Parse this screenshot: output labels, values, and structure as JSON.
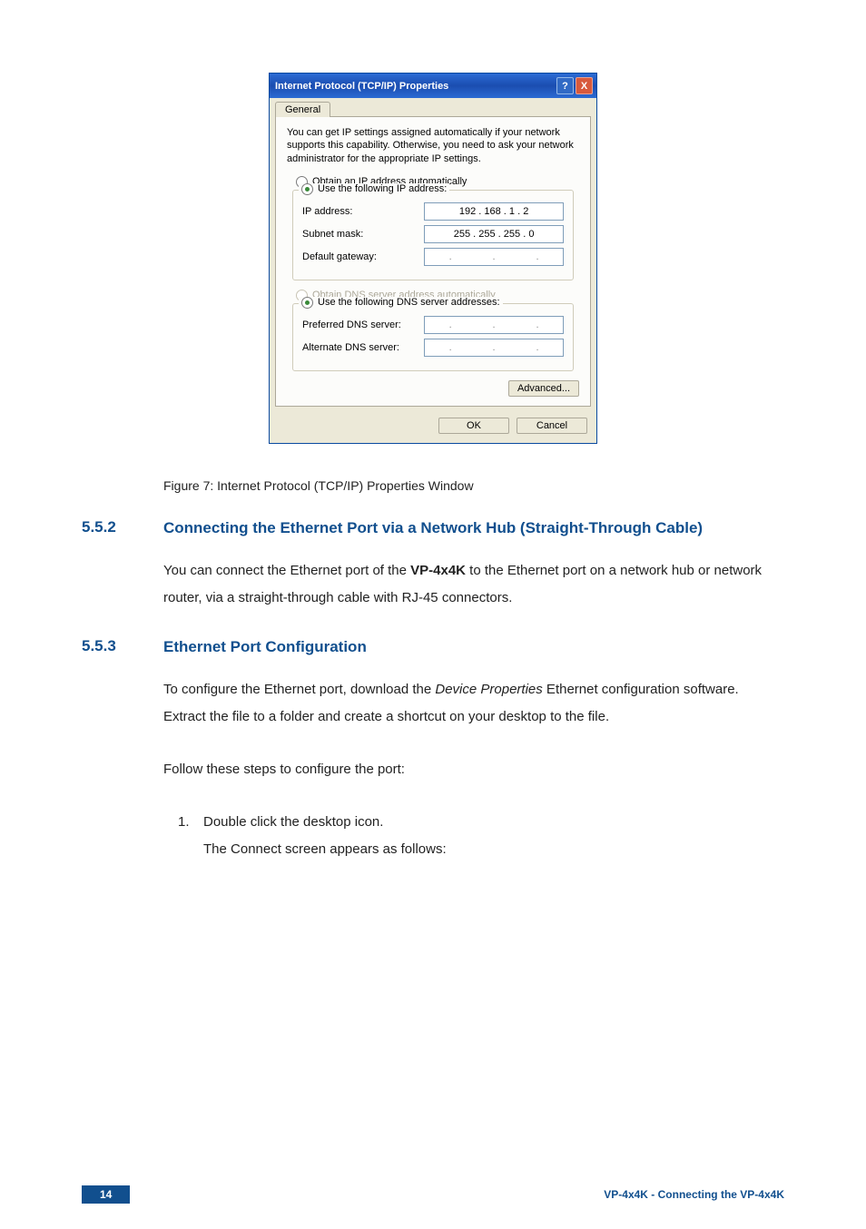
{
  "dialog": {
    "title": "Internet Protocol (TCP/IP) Properties",
    "tab": "General",
    "info": "You can get IP settings assigned automatically if your network supports this capability. Otherwise, you need to ask your network administrator for the appropriate IP settings.",
    "radio_obtain_ip": "Obtain an IP address automatically",
    "radio_use_ip": "Use the following IP address:",
    "label_ip": "IP address:",
    "value_ip": "192 . 168 .  1  .  2",
    "label_subnet": "Subnet mask:",
    "value_subnet": "255 . 255 . 255 .  0",
    "label_gateway": "Default gateway:",
    "value_gateway": ".       .       .",
    "radio_obtain_dns": "Obtain DNS server address automatically",
    "radio_use_dns": "Use the following DNS server addresses:",
    "label_pref_dns": "Preferred DNS server:",
    "value_pref_dns": ".       .       .",
    "label_alt_dns": "Alternate DNS server:",
    "value_alt_dns": ".       .       .",
    "btn_advanced": "Advanced...",
    "btn_ok": "OK",
    "btn_cancel": "Cancel",
    "help_glyph": "?",
    "close_glyph": "X"
  },
  "figure_caption": "Figure 7: Internet Protocol (TCP/IP) Properties Window",
  "section_552": {
    "num": "5.5.2",
    "title": "Connecting the Ethernet Port via a Network Hub (Straight-Through Cable)",
    "body_pre": "You can connect the Ethernet port of the ",
    "body_bold": "VP-4x4K",
    "body_post": " to the Ethernet port on a network hub or network router, via a straight-through cable with RJ-45 connectors."
  },
  "section_553": {
    "num": "5.5.3",
    "title": "Ethernet Port Configuration",
    "body_pre": "To configure the Ethernet port, download the ",
    "body_italic": "Device Properties",
    "body_post": " Ethernet configuration software. Extract the file to a folder and create a shortcut on your desktop to the file.",
    "follow": "Follow these steps to configure the port:",
    "step1_num": "1.",
    "step1": "Double click the desktop icon.",
    "step1_cont": "The Connect screen appears as follows:"
  },
  "footer": {
    "page": "14",
    "right": "VP-4x4K - Connecting the VP-4x4K"
  }
}
